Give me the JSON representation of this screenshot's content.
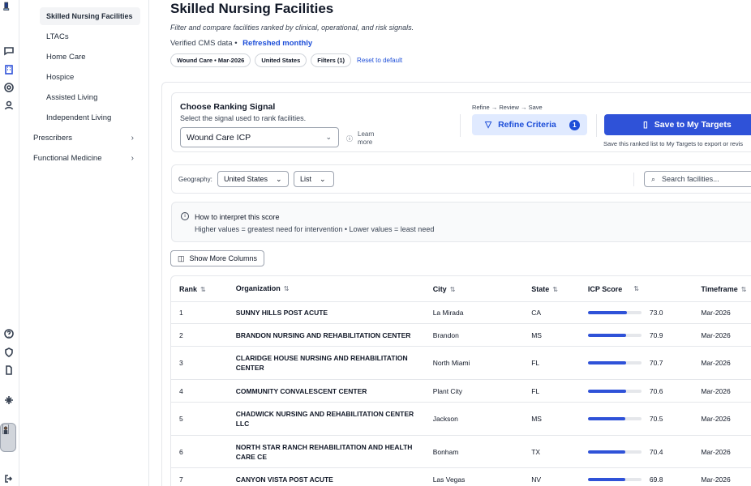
{
  "sidebar": {
    "active": "Skilled Nursing Facilities",
    "items": [
      "LTACs",
      "Home Care",
      "Hospice",
      "Assisted Living",
      "Independent Living"
    ],
    "groups": [
      "Prescribers",
      "Functional Medicine"
    ]
  },
  "page": {
    "title": "Skilled Nursing Facilities",
    "subtitle": "Filter and compare facilities ranked by clinical, operational, and risk signals.",
    "verified": "Verified CMS data •",
    "refreshed": "Refreshed monthly",
    "chips": [
      "Wound Care • Mar-2026",
      "United States",
      "Filters (1)"
    ],
    "reset": "Reset to default"
  },
  "ranking": {
    "title": "Choose Ranking Signal",
    "subtitle": "Select the signal used to rank facilities.",
    "signal": "Wound Care ICP",
    "learn_more": "Learn more",
    "steps": "Refine → Review → Save",
    "refine_label": "Refine Criteria",
    "refine_count": "1",
    "save_label": "Save to My Targets",
    "save_note": "Save this ranked list to My Targets to export or revis"
  },
  "filters": {
    "geography_label": "Geography:",
    "geography": "United States",
    "view": "List",
    "search_placeholder": "Search facilities..."
  },
  "info": {
    "title": "How to interpret this score",
    "text": "Higher values = greatest need for intervention • Lower values = least need"
  },
  "show_more": "Show More Columns",
  "table": {
    "headers": [
      "Rank",
      "Organization",
      "City",
      "State",
      "ICP Score",
      "Timeframe"
    ],
    "rows": [
      {
        "rank": "1",
        "org": "SUNNY HILLS POST ACUTE",
        "city": "La Mirada",
        "state": "CA",
        "score": "73.0",
        "time": "Mar-2026"
      },
      {
        "rank": "2",
        "org": "BRANDON NURSING AND REHABILITATION CENTER",
        "city": "Brandon",
        "state": "MS",
        "score": "70.9",
        "time": "Mar-2026"
      },
      {
        "rank": "3",
        "org": "CLARIDGE HOUSE NURSING AND REHABILITATION CENTER",
        "city": "North Miami",
        "state": "FL",
        "score": "70.7",
        "time": "Mar-2026"
      },
      {
        "rank": "4",
        "org": "COMMUNITY CONVALESCENT CENTER",
        "city": "Plant City",
        "state": "FL",
        "score": "70.6",
        "time": "Mar-2026"
      },
      {
        "rank": "5",
        "org": "CHADWICK NURSING AND REHABILITATION CENTER LLC",
        "city": "Jackson",
        "state": "MS",
        "score": "70.5",
        "time": "Mar-2026"
      },
      {
        "rank": "6",
        "org": "NORTH STAR RANCH REHABILITATION AND HEALTH CARE CE",
        "city": "Bonham",
        "state": "TX",
        "score": "70.4",
        "time": "Mar-2026"
      },
      {
        "rank": "7",
        "org": "CANYON VISTA POST ACUTE",
        "city": "Las Vegas",
        "state": "NV",
        "score": "69.8",
        "time": "Mar-2026"
      }
    ]
  },
  "colors": {
    "accent": "#2f52d8",
    "link": "#1d4ed8"
  }
}
